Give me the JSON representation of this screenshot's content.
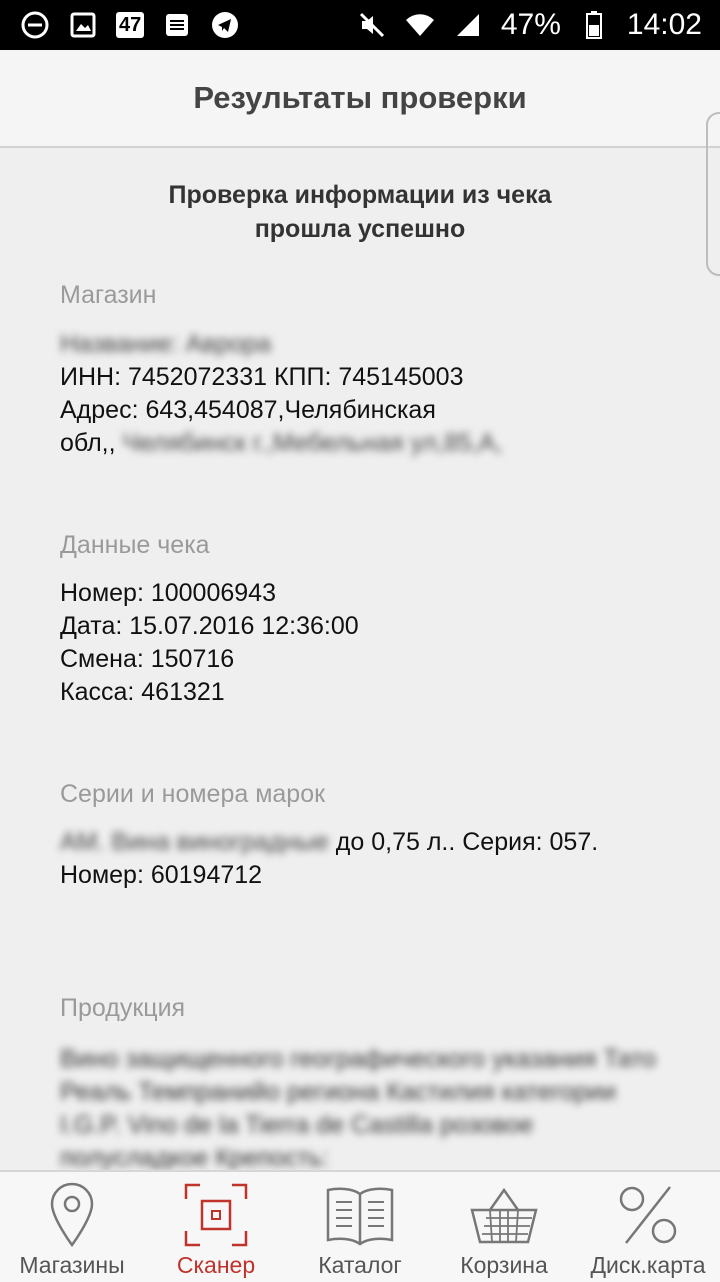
{
  "statusbar": {
    "notification_count": "47",
    "battery_percent": "47%",
    "time": "14:02"
  },
  "header": {
    "title": "Результаты проверки"
  },
  "result": {
    "line1": "Проверка информации из чека",
    "line2": "прошла успешно"
  },
  "store": {
    "label": "Магазин",
    "name_blurred": "Название: Аврора",
    "inn_kpp": "ИНН: 7452072331 КПП: 745145003",
    "address_line1": "Адрес: 643,454087,Челябинская",
    "address_line2_prefix": "обл,,",
    "address_line2_blurred": "Челябинск г.,Мебельная ул,85,А,"
  },
  "receipt": {
    "label": "Данные чека",
    "number": "Номер: 100006943",
    "date": "Дата: 15.07.2016 12:36:00",
    "shift": "Смена: 150716",
    "register": "Касса: 461321"
  },
  "stamps": {
    "label": "Серии и номера марок",
    "line1_blurred": "АМ. Вина виноградные",
    "line1_rest": " до 0,75 л.. Серия: 057.",
    "line2": "Номер: 60194712"
  },
  "products": {
    "label": "Продукция",
    "text_blurred": "Вино защищенного географического указания Тато Реаль Темпранийо региона Кастилия категории I.G.P. Vino de la Tierra de Castilla розовое полусладкое Крепость:"
  },
  "bottom_nav": [
    {
      "label": "Магазины",
      "icon": "map-pin-icon"
    },
    {
      "label": "Сканер",
      "icon": "scanner-icon"
    },
    {
      "label": "Каталог",
      "icon": "book-icon"
    },
    {
      "label": "Корзина",
      "icon": "basket-icon"
    },
    {
      "label": "Диск.карта",
      "icon": "percent-icon"
    }
  ],
  "colors": {
    "accent": "#c0332b",
    "background": "#efefef",
    "label_gray": "#9a9a9a"
  }
}
